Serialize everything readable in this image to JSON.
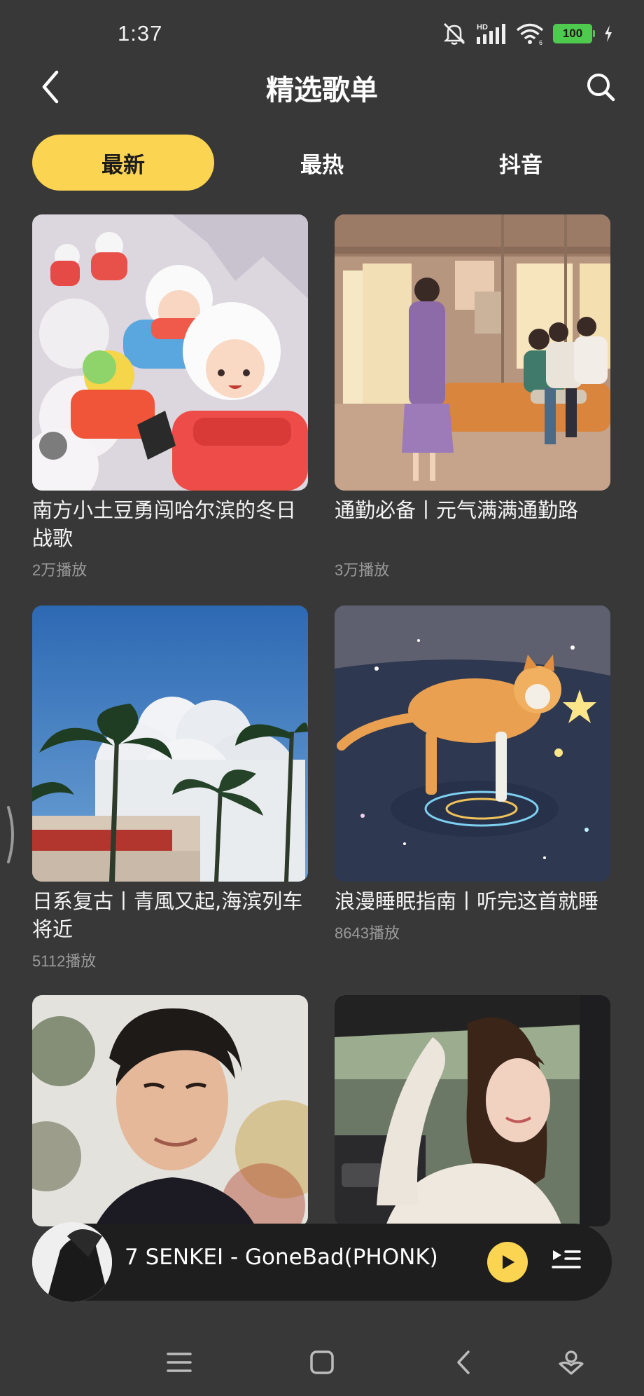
{
  "status_bar": {
    "time": "1:37",
    "battery": "100",
    "network_label": "HD",
    "icons": [
      "mute-icon",
      "signal-icon",
      "wifi-icon",
      "battery-icon",
      "charging-icon"
    ]
  },
  "header": {
    "title": "精选歌单",
    "back_icon": "chevron-left-icon",
    "search_icon": "search-icon"
  },
  "tabs": [
    {
      "label": "最新",
      "active": true
    },
    {
      "label": "最热",
      "active": false
    },
    {
      "label": "抖音",
      "active": false
    }
  ],
  "playlists": [
    {
      "title": "南方小土豆勇闯哈尔滨的冬日战歌",
      "plays": "2万播放"
    },
    {
      "title": "通勤必备丨元气满满通勤路",
      "plays": "3万播放"
    },
    {
      "title": "日系复古丨青風又起,海滨列车将近",
      "plays": "5112播放"
    },
    {
      "title": "浪漫睡眠指南丨听完这首就睡",
      "plays": "8643播放"
    }
  ],
  "mini_player": {
    "song": "7 SENKEI - GoneBad(PHONK)",
    "play_icon": "play-icon",
    "playlist_icon": "playlist-icon"
  },
  "nav_bar": {
    "icons": [
      "menu-icon",
      "home-icon",
      "back-icon",
      "assistant-icon"
    ]
  },
  "colors": {
    "background": "#383838",
    "accent": "#fbd451",
    "player_background": "#1e1e1e"
  }
}
